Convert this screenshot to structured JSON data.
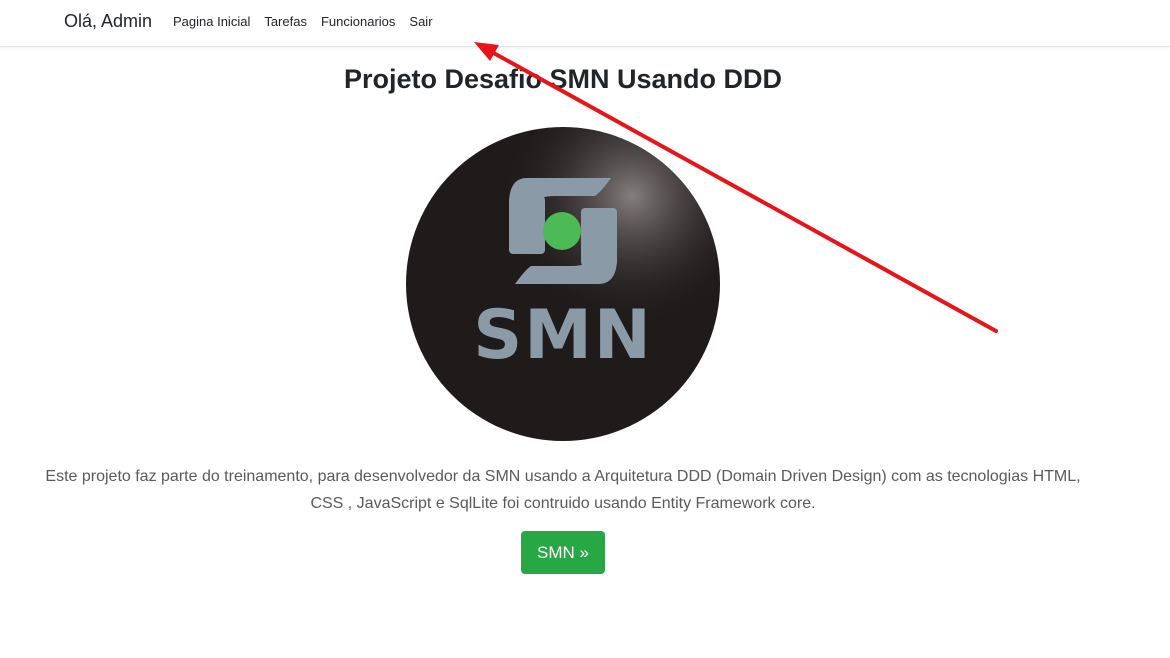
{
  "navbar": {
    "brand": "Olá, Admin",
    "links": [
      "Pagina Inicial",
      "Tarefas",
      "Funcionarios",
      "Sair"
    ]
  },
  "main": {
    "title": "Projeto Desafio SMN Usando DDD",
    "logo_text": "SMN",
    "description": "Este projeto faz parte do treinamento, para desenvolvedor da SMN usando a Arquitetura DDD (Domain Driven Design) com as tecnologias HTML, CSS , JavaScript e SqlLite foi contruido usando Entity Framework core.",
    "button_label": "SMN »"
  },
  "colors": {
    "accent_button": "#28a745",
    "annotation_arrow": "#e8141a",
    "logo_background": "#1f1b1b",
    "logo_mark": "#8a9ba7",
    "logo_dot": "#4cba55"
  }
}
